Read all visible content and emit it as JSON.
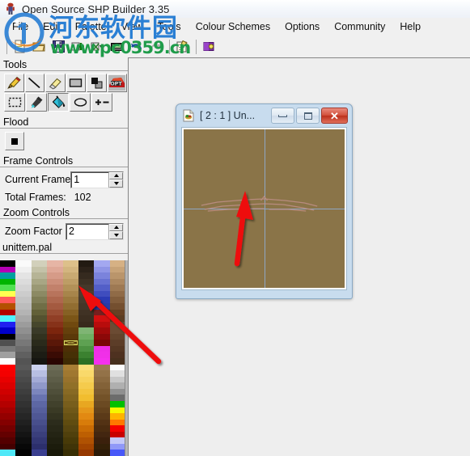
{
  "window": {
    "title": "Open Source SHP Builder 3.35",
    "icon": "app-icon"
  },
  "menu": {
    "items": [
      {
        "label": "File"
      },
      {
        "label": "Edit"
      },
      {
        "label": "Palette"
      },
      {
        "label": "View"
      },
      {
        "label": "Tools"
      },
      {
        "label": "Colour Schemes"
      },
      {
        "label": "Options"
      },
      {
        "label": "Community"
      },
      {
        "label": "Help"
      }
    ]
  },
  "toolbar": {
    "buttons": [
      {
        "name": "new-icon",
        "tooltip": "New"
      },
      {
        "name": "open-icon",
        "tooltip": "Open"
      },
      {
        "name": "save-icon",
        "tooltip": "Save"
      },
      {
        "name": "add-frame-icon",
        "tooltip": "Add Frame"
      },
      {
        "name": "delete-frame-icon",
        "tooltip": "Delete Frame"
      },
      {
        "name": "insert-frame-icon",
        "tooltip": "Insert Frame"
      },
      {
        "name": "undo-icon",
        "tooltip": "Undo"
      },
      {
        "name": "redo-icon",
        "tooltip": "Redo"
      },
      {
        "name": "properties-icon",
        "tooltip": "Properties"
      },
      {
        "name": "palette-book-icon",
        "tooltip": "Palette"
      }
    ]
  },
  "panels": {
    "tools": {
      "title": "Tools",
      "items": [
        {
          "name": "pencil-tool",
          "label": "Pencil",
          "selected": false
        },
        {
          "name": "line-tool",
          "label": "Line",
          "selected": false
        },
        {
          "name": "eraser-tool",
          "label": "Eraser",
          "selected": false
        },
        {
          "name": "rectangle-tool",
          "label": "Rectangle",
          "selected": false
        },
        {
          "name": "filled-shape-tool",
          "label": "Filled Shape",
          "selected": false
        },
        {
          "name": "opt-tool",
          "label": "OPT",
          "selected": false
        },
        {
          "name": "select-tool",
          "label": "Select",
          "selected": false
        },
        {
          "name": "eyedropper-tool",
          "label": "Colour Picker",
          "selected": false
        },
        {
          "name": "paint-bucket-tool",
          "label": "Flood Fill",
          "selected": true
        },
        {
          "name": "ellipse-tool",
          "label": "Ellipse",
          "selected": false
        },
        {
          "name": "plusminus-tool",
          "label": "Shift Colours",
          "selected": false
        }
      ]
    },
    "flood": {
      "title": "Flood",
      "swatch_color": "#000000"
    },
    "frame_controls": {
      "title": "Frame Controls",
      "current_frame_label": "Current Frame",
      "current_frame_value": "1",
      "total_frames_label": "Total Frames:",
      "total_frames_value": "102"
    },
    "zoom_controls": {
      "title": "Zoom Controls",
      "zoom_factor_label": "Zoom Factor",
      "zoom_factor_value": "2"
    },
    "palette": {
      "filename": "unittem.pal",
      "columns": 8,
      "selected_index": 108,
      "colors": [
        "#000000",
        "#fafafa",
        "#d2d0bb",
        "#e6b5a5",
        "#ddc08a",
        "#221a12",
        "#a3a8f0",
        "#d6b184",
        "#b400b4",
        "#f0f0f0",
        "#c4c2a8",
        "#dfa897",
        "#d3b57f",
        "#2c2219",
        "#8f95e6",
        "#c8a377",
        "#00a0a0",
        "#e4e4e4",
        "#b6b496",
        "#d69b88",
        "#c8a972",
        "#352a1f",
        "#7b83dc",
        "#ba956b",
        "#00b400",
        "#dcdcdc",
        "#a8a684",
        "#cc8e79",
        "#bd9d65",
        "#3d3124",
        "#6771d2",
        "#ac875f",
        "#50e050",
        "#d4d4d4",
        "#9a9874",
        "#c2816b",
        "#b29158",
        "#45382a",
        "#535fc8",
        "#9e7953",
        "#ffff50",
        "#cccccc",
        "#8c8a64",
        "#b8745c",
        "#a7854b",
        "#4c3e2f",
        "#3f4dbe",
        "#906b47",
        "#ff5a5a",
        "#c4c4c4",
        "#7e7c55",
        "#ae674e",
        "#9c793e",
        "#483a2c",
        "#2b3bb4",
        "#825d3b",
        "#b45000",
        "#bcbcbc",
        "#706e46",
        "#a45a40",
        "#916d31",
        "#443628",
        "#2a3aa5",
        "#744f2f",
        "#b40000",
        "#b4b4b4",
        "#626038",
        "#9a4d33",
        "#866124",
        "#403224",
        "#771f1f",
        "#664123",
        "#50f0ff",
        "#a8a8a8",
        "#545230",
        "#903f26",
        "#7b5517",
        "#3c2e20",
        "#d01010",
        "#5b3c22",
        "#2020f0",
        "#9c9c9c",
        "#46462c",
        "#863219",
        "#70490f",
        "#382a1c",
        "#b80c0c",
        "#6b4b33",
        "#0000c8",
        "#909090",
        "#3a3a28",
        "#7c250d",
        "#65400c",
        "#7fb574",
        "#a00a0a",
        "#6b4b33",
        "#000000",
        "#848484",
        "#32321f",
        "#6a1d0a",
        "#5b3909",
        "#6fae63",
        "#8b0808",
        "#63442c",
        "#505050",
        "#787878",
        "#2a2a1b",
        "#5a1708",
        "#543407",
        "#5ea152",
        "#7a0606",
        "#5c3d28",
        "#787878",
        "#6c6c6c",
        "#232318",
        "#4a1106",
        "#4d2f06",
        "#4c9141",
        "#ee2ee6",
        "#553723",
        "#a0a0a0",
        "#606060",
        "#1c1c14",
        "#3a0b04",
        "#463005",
        "#3b8130",
        "#f030e8",
        "#4e3120",
        "#ffffff",
        "#545454",
        "#151510",
        "#2a0602",
        "#3f2b04",
        "#2c7125",
        "#f530ee",
        "#47301d",
        "#ff0000",
        "#585858",
        "#ccd2ef",
        "#6b6b56",
        "#a87e34",
        "#fbe07a",
        "#9b7a52",
        "#fcfcfc",
        "#f40000",
        "#505050",
        "#b8bfe2",
        "#64644f",
        "#a07830",
        "#f9d96b",
        "#937248",
        "#e0e0e0",
        "#e80000",
        "#4a4a4a",
        "#a4abd6",
        "#5d5d48",
        "#98722c",
        "#f7d25c",
        "#8b6a40",
        "#c8c8c8",
        "#dc0000",
        "#444444",
        "#9099c9",
        "#565641",
        "#907028",
        "#f5cb4d",
        "#836238",
        "#b0b0b0",
        "#d00000",
        "#3e3e3e",
        "#7c86bd",
        "#4f4f3a",
        "#886a24",
        "#f3c43e",
        "#7b5a30",
        "#909090",
        "#c40000",
        "#383838",
        "#6873b0",
        "#484833",
        "#806420",
        "#f1bd2f",
        "#735228",
        "#6c6c6c",
        "#b40000",
        "#323232",
        "#5d67a4",
        "#41412c",
        "#785e1c",
        "#e8a721",
        "#6b4a22",
        "#00c000",
        "#a40000",
        "#2c2c2c",
        "#565f9c",
        "#3a3a25",
        "#705818",
        "#e5971a",
        "#63421c",
        "#f8f800",
        "#940000",
        "#262626",
        "#4f5794",
        "#333320",
        "#685214",
        "#e28912",
        "#5b3a18",
        "#ffb400",
        "#840000",
        "#202020",
        "#484f8c",
        "#2c2c1c",
        "#604c10",
        "#d87c0a",
        "#533214",
        "#ff7800",
        "#740000",
        "#1a1a1a",
        "#414784",
        "#282818",
        "#584610",
        "#ca6c04",
        "#4b2c10",
        "#f40000",
        "#640000",
        "#141414",
        "#3a3f7c",
        "#242414",
        "#50400c",
        "#bd5f02",
        "#432610",
        "#c80000",
        "#540000",
        "#0e0e0e",
        "#333774",
        "#202010",
        "#483a08",
        "#b05202",
        "#3b200c",
        "#c4c8f8",
        "#440000",
        "#080808",
        "#2c2f6c",
        "#1c1c0c",
        "#403408",
        "#a34500",
        "#332008",
        "#9098f8",
        "#50e8f8",
        "#020202",
        "#3a3f90",
        "#181808",
        "#382e04",
        "#963800",
        "#2b1a08",
        "#4858f8"
      ]
    }
  },
  "child_window": {
    "icon": "document-icon",
    "title": "[ 2 : 1 ] Un...",
    "buttons": {
      "minimize": "minimize-button",
      "maximize": "maximize-button",
      "close": "close-button"
    },
    "canvas": {
      "background_color": "#8a7448",
      "guide_color": "#8fa7c4",
      "sprite_color": "#c09088"
    }
  },
  "watermark": {
    "cn_text": "河东软件园",
    "url": "www.pc0359.cn"
  }
}
